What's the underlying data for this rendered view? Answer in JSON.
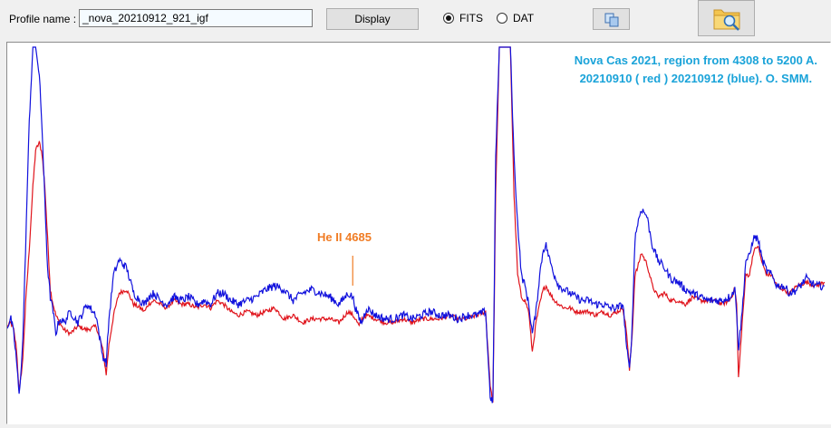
{
  "form": {
    "profile_label": "Profile name :",
    "profile_value": "_nova_20210912_921_igf",
    "display_button": "Display",
    "radio_fits": "FITS",
    "radio_dat": "DAT",
    "selected_format": "FITS"
  },
  "icons": {
    "copy": "copy-icon",
    "open": "folder-search-icon"
  },
  "chart_data": {
    "type": "line",
    "title_line1": "Nova Cas 2021, region from 4308 to 5200 A.",
    "title_line2": "20210910 ( red ) 20210912 (blue).  O. SMM.",
    "annotation": "He II 4685",
    "annotation_x": 4685,
    "xlim": [
      4308,
      5200
    ],
    "ylim": [
      0,
      100
    ],
    "xlabel": "",
    "ylabel": "",
    "grid": false,
    "series": [
      {
        "date": "20210910",
        "color": "#e0141c",
        "x": [
          4308,
          4312,
          4315,
          4318,
          4321,
          4325,
          4328,
          4332,
          4336,
          4339,
          4343,
          4346,
          4349,
          4352,
          4355,
          4358,
          4361,
          4365,
          4370,
          4377,
          4385,
          4395,
          4405,
          4412,
          4416,
          4419,
          4424,
          4430,
          4438,
          4446,
          4453,
          4458,
          4462,
          4468,
          4475,
          4482,
          4490,
          4498,
          4506,
          4515,
          4523,
          4530,
          4537,
          4544,
          4552,
          4560,
          4570,
          4580,
          4590,
          4600,
          4610,
          4620,
          4630,
          4640,
          4650,
          4660,
          4670,
          4680,
          4685,
          4688,
          4692,
          4695,
          4700,
          4710,
          4720,
          4730,
          4740,
          4750,
          4760,
          4770,
          4780,
          4790,
          4800,
          4810,
          4820,
          4830,
          4835,
          4838,
          4841,
          4845,
          4849,
          4853,
          4857,
          4861,
          4865,
          4869,
          4873,
          4877,
          4881,
          4885,
          4889,
          4893,
          4896,
          4900,
          4905,
          4910,
          4916,
          4922,
          4928,
          4935,
          4942,
          4950,
          4958,
          4966,
          4974,
          4980,
          4984,
          4987,
          4990,
          4993,
          4996,
          5000,
          5006,
          5012,
          5018,
          5025,
          5032,
          5040,
          5048,
          5056,
          5064,
          5072,
          5080,
          5088,
          5096,
          5102,
          5104,
          5106,
          5110,
          5114,
          5118,
          5122,
          5127,
          5132,
          5137,
          5142,
          5148,
          5155,
          5162,
          5170,
          5180,
          5190,
          5200
        ],
        "y": [
          24,
          25,
          23,
          18,
          6,
          15,
          30,
          45,
          62,
          72,
          74,
          71,
          62,
          48,
          34,
          30,
          27,
          25,
          23,
          22,
          24,
          23,
          24,
          18,
          11,
          19,
          27,
          33,
          34,
          30,
          29,
          28,
          30,
          31,
          30,
          29,
          31,
          30,
          30,
          29,
          30,
          29,
          31,
          30,
          28,
          27,
          28,
          27,
          28,
          29,
          26,
          27,
          25,
          26,
          26,
          26,
          25,
          28,
          27,
          26,
          24,
          26,
          27,
          26,
          25,
          25,
          26,
          25,
          26,
          26,
          26,
          27,
          26,
          26,
          27,
          28,
          8,
          3,
          60,
          100,
          100,
          100,
          100,
          60,
          38,
          32,
          31,
          28,
          17,
          25,
          30,
          34,
          35,
          33,
          31,
          30,
          29,
          29,
          28,
          28,
          28,
          27,
          28,
          27,
          28,
          29,
          22,
          12,
          22,
          38,
          40,
          44,
          41,
          35,
          32,
          33,
          31,
          31,
          30,
          32,
          31,
          31,
          31,
          30,
          31,
          34,
          30,
          10,
          25,
          38,
          38,
          44,
          46,
          41,
          38,
          38,
          35,
          34,
          33,
          35,
          36,
          35,
          36
        ]
      },
      {
        "date": "20210912",
        "color": "#1111dd",
        "x": [
          4308,
          4312,
          4315,
          4318,
          4321,
          4325,
          4328,
          4332,
          4336,
          4339,
          4343,
          4346,
          4349,
          4352,
          4355,
          4358,
          4361,
          4365,
          4370,
          4377,
          4385,
          4395,
          4405,
          4412,
          4416,
          4419,
          4424,
          4430,
          4438,
          4446,
          4453,
          4458,
          4462,
          4468,
          4475,
          4482,
          4490,
          4498,
          4506,
          4515,
          4523,
          4530,
          4537,
          4544,
          4552,
          4560,
          4570,
          4580,
          4590,
          4600,
          4610,
          4620,
          4630,
          4640,
          4650,
          4660,
          4670,
          4680,
          4685,
          4688,
          4692,
          4695,
          4700,
          4710,
          4720,
          4730,
          4740,
          4750,
          4760,
          4770,
          4780,
          4790,
          4800,
          4810,
          4820,
          4830,
          4835,
          4838,
          4841,
          4845,
          4849,
          4853,
          4857,
          4861,
          4865,
          4869,
          4873,
          4877,
          4881,
          4885,
          4889,
          4893,
          4896,
          4900,
          4905,
          4910,
          4916,
          4922,
          4928,
          4935,
          4942,
          4950,
          4958,
          4966,
          4974,
          4980,
          4984,
          4987,
          4990,
          4993,
          4996,
          5000,
          5006,
          5012,
          5018,
          5025,
          5032,
          5040,
          5048,
          5056,
          5064,
          5072,
          5080,
          5088,
          5096,
          5102,
          5104,
          5106,
          5110,
          5114,
          5118,
          5122,
          5127,
          5132,
          5137,
          5142,
          5148,
          5155,
          5162,
          5170,
          5180,
          5190,
          5200
        ],
        "y": [
          24,
          26,
          22,
          15,
          5,
          20,
          45,
          80,
          100,
          100,
          92,
          78,
          58,
          40,
          32,
          28,
          22,
          26,
          25,
          28,
          25,
          30,
          27,
          16,
          14,
          26,
          38,
          42,
          40,
          33,
          31,
          30,
          32,
          33,
          31,
          30,
          32,
          31,
          32,
          30,
          31,
          30,
          33,
          33,
          31,
          30,
          31,
          32,
          34,
          35,
          34,
          31,
          33,
          34,
          33,
          32,
          30,
          33,
          32,
          29,
          26,
          25,
          29,
          27,
          26,
          26,
          27,
          26,
          27,
          28,
          27,
          27,
          26,
          27,
          27,
          28,
          5,
          3,
          70,
          100,
          100,
          100,
          100,
          70,
          52,
          38,
          35,
          30,
          22,
          28,
          38,
          45,
          46,
          42,
          38,
          35,
          34,
          33,
          32,
          31,
          31,
          30,
          30,
          29,
          29,
          30,
          18,
          12,
          24,
          48,
          52,
          56,
          54,
          46,
          42,
          40,
          37,
          36,
          34,
          33,
          32,
          31,
          31,
          31,
          32,
          34,
          28,
          18,
          28,
          42,
          43,
          48,
          48,
          42,
          39,
          38,
          35,
          35,
          33,
          34,
          37,
          35,
          35
        ]
      }
    ]
  }
}
